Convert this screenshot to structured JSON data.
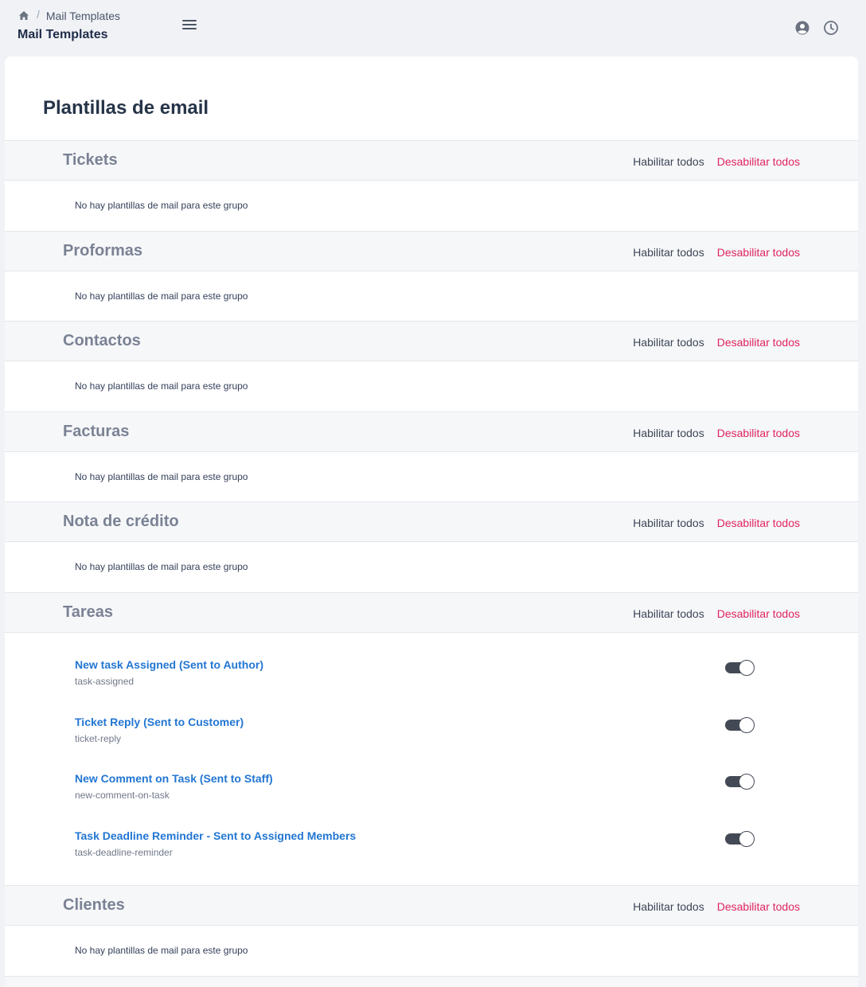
{
  "breadcrumb": {
    "current": "Mail Templates",
    "separator": "/"
  },
  "page_heading": "Mail Templates",
  "title": "Plantillas de email",
  "actions": {
    "enable_all": "Habilitar todos",
    "disable_all": "Desabilitar todos"
  },
  "empty_message": "No hay plantillas de mail para este grupo",
  "groups": [
    {
      "name": "Tickets"
    },
    {
      "name": "Proformas"
    },
    {
      "name": "Contactos"
    },
    {
      "name": "Facturas"
    },
    {
      "name": "Nota de crédito"
    },
    {
      "name": "Tareas",
      "templates": [
        {
          "name": "New task Assigned (Sent to Author)",
          "slug": "task-assigned",
          "enabled": true
        },
        {
          "name": "Ticket Reply (Sent to Customer)",
          "slug": "ticket-reply",
          "enabled": true
        },
        {
          "name": "New Comment on Task (Sent to Staff)",
          "slug": "new-comment-on-task",
          "enabled": true
        },
        {
          "name": "Task Deadline Reminder - Sent to Assigned Members",
          "slug": "task-deadline-reminder",
          "enabled": true
        }
      ]
    },
    {
      "name": "Clientes"
    }
  ],
  "colors": {
    "link": "#2276d2",
    "danger": "#e0245e",
    "toggle_on": "#444a55"
  },
  "icons": {
    "home": "home-icon",
    "menu": "hamburger-menu-icon",
    "user": "user-circle-icon",
    "clock": "clock-icon"
  }
}
